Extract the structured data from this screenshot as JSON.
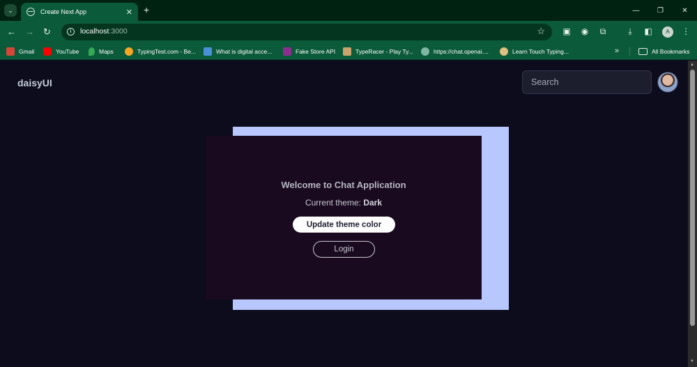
{
  "browser": {
    "tab": {
      "title": "Create Next App",
      "close": "✕"
    },
    "new_tab": "+",
    "window_controls": {
      "minimize": "—",
      "maximize": "❐",
      "close": "✕"
    },
    "address": {
      "host": "localhost",
      "port": ":3000"
    },
    "profile_initial": "A",
    "bookmarks": [
      {
        "label": "Gmail",
        "icon": "gmail-icon",
        "color": "#d44638"
      },
      {
        "label": "YouTube",
        "icon": "youtube-icon",
        "color": "#ff0000"
      },
      {
        "label": "Maps",
        "icon": "maps-icon",
        "color": "#34a853"
      },
      {
        "label": "TypingTest.com - Be...",
        "icon": "typingtest-icon",
        "color": "#f5a623"
      },
      {
        "label": "What is digital acce...",
        "icon": "accessibility-icon",
        "color": "#4a90d9"
      },
      {
        "label": "Fake Store API",
        "icon": "fakestore-icon",
        "color": "#8b2f8f"
      },
      {
        "label": "TypeRacer - Play Ty...",
        "icon": "typeracer-icon",
        "color": "#c9a36b"
      },
      {
        "label": "https://chat.openai....",
        "icon": "openai-icon",
        "color": "#7fb7a4"
      },
      {
        "label": "Learn Touch Typing...",
        "icon": "touchtyping-icon",
        "color": "#e0c080"
      }
    ],
    "bookmarks_more": "»",
    "all_bookmarks": "All Bookmarks"
  },
  "page": {
    "brand": "daisyUI",
    "search": {
      "placeholder": "Search"
    },
    "hero": {
      "title": "Welcome to Chat Application",
      "theme_prefix": "Current theme:",
      "theme_value": "Dark",
      "update_button": "Update theme color",
      "login_button": "Login"
    },
    "colors": {
      "page_bg": "#0c0c1d",
      "hero_back": "#b8c7fd",
      "hero_card": "#1a0a1f",
      "chrome_green": "#0b5a3a"
    }
  }
}
